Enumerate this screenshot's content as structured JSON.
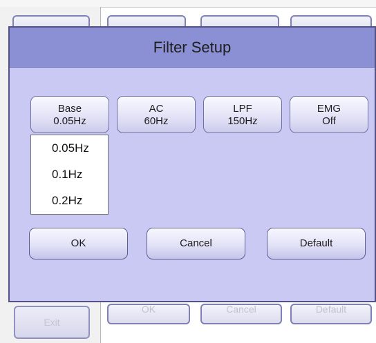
{
  "background": {
    "exit_label": "Exit",
    "bottom_buttons": [
      "OK",
      "Cancel",
      "Default"
    ]
  },
  "dialog": {
    "title": "Filter Setup",
    "filters": [
      {
        "label": "Base",
        "value": "0.05Hz"
      },
      {
        "label": "AC",
        "value": "60Hz"
      },
      {
        "label": "LPF",
        "value": "150Hz"
      },
      {
        "label": "EMG",
        "value": "Off"
      }
    ],
    "dropdown": {
      "options": [
        "0.05Hz",
        "0.1Hz",
        "0.2Hz"
      ]
    },
    "actions": {
      "ok": "OK",
      "cancel": "Cancel",
      "default": "Default"
    }
  },
  "colors": {
    "dialog_bg": "#c9c9f3",
    "titlebar_bg": "#8b8fd4",
    "button_border": "#6e6ea0"
  }
}
